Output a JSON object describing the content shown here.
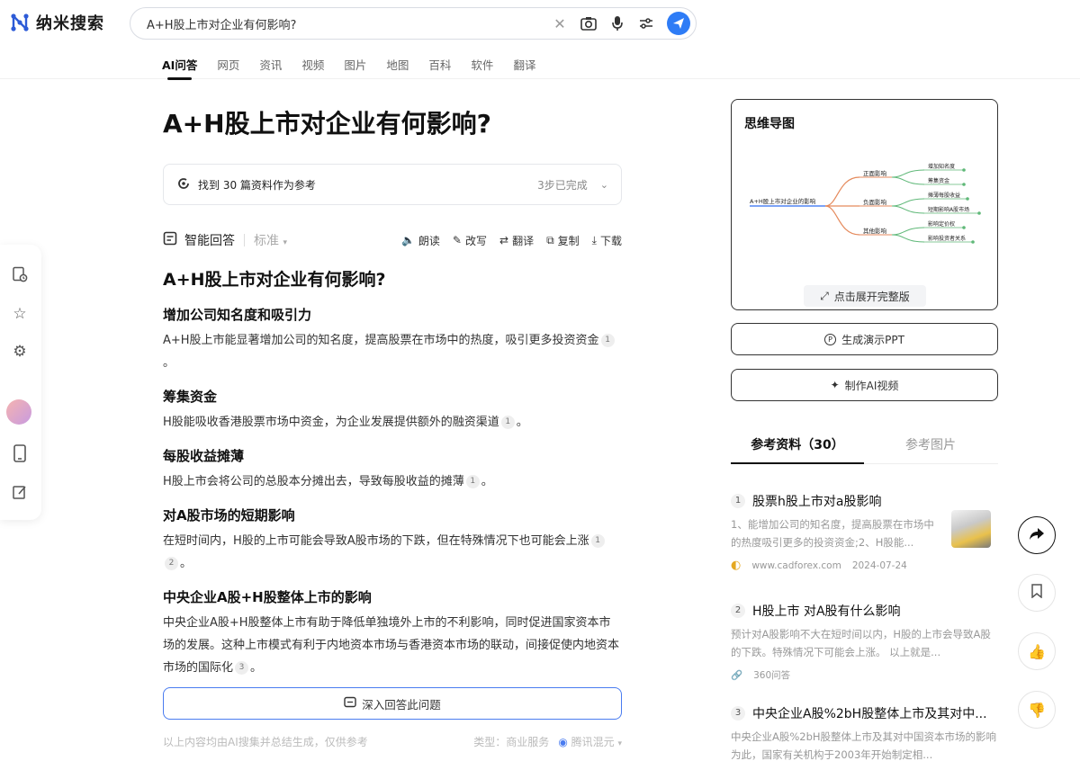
{
  "header": {
    "logo_text": "纳米搜索",
    "search_value": "A+H股上市对企业有何影响?",
    "tabs": [
      "AI问答",
      "网页",
      "资讯",
      "视频",
      "图片",
      "地图",
      "百科",
      "软件",
      "翻译"
    ]
  },
  "main": {
    "title": "A+H股上市对企业有何影响?",
    "ref_found": "找到 30 篇资料作为参考",
    "ref_status": "3步已完成",
    "answer_label": "智能回答",
    "mode_label": "标准",
    "actions": [
      "朗读",
      "改写",
      "翻译",
      "复制",
      "下载"
    ],
    "answer_title": "A+H股上市对企业有何影响?",
    "sections": [
      {
        "heading": "增加公司知名度和吸引力",
        "text": "A+H股上市能显著增加公司的知名度，提高股票在市场中的热度，吸引更多投资资金",
        "cites": [
          "1"
        ]
      },
      {
        "heading": "筹集资金",
        "text": "H股能吸收香港股票市场中资金，为企业发展提供额外的融资渠道",
        "cites": [
          "1"
        ]
      },
      {
        "heading": "每股收益摊薄",
        "text": "H股上市会将公司的总股本分摊出去，导致每股收益的摊薄",
        "cites": [
          "1"
        ]
      },
      {
        "heading": "对A股市场的短期影响",
        "text": "在短时间内，H股的上市可能会导致A股市场的下跌，但在特殊情况下也可能会上涨",
        "cites": [
          "1",
          "2"
        ]
      },
      {
        "heading": "中央企业A股+H股整体上市的影响",
        "text": "中央企业A股+H股整体上市有助于降低单独境外上市的不利影响，同时促进国家资本市场的发展。这种上市模式有利于内地资本市场与香港资本市场的联动，间接促使内地资本市场的国际化",
        "cites": [
          "3"
        ]
      }
    ],
    "deep_button": "深入回答此问题",
    "footer_left": "以上内容均由AI搜集并总结生成，仅供参考",
    "footer_type": "类型：商业服务",
    "footer_source": "腾讯混元"
  },
  "mindmap": {
    "title": "思维导图",
    "root": "A+H股上市对企业的影响",
    "branches": [
      {
        "label": "正面影响",
        "leaves": [
          "增加知名度",
          "筹集资金"
        ]
      },
      {
        "label": "负面影响",
        "leaves": [
          "摊薄每股收益",
          "短期影响A股市场"
        ]
      },
      {
        "label": "其他影响",
        "leaves": [
          "影响定价权",
          "影响投资者关系"
        ]
      }
    ],
    "expand_label": "点击展开完整版"
  },
  "side_buttons": {
    "ppt": "生成演示PPT",
    "video": "制作AI视频"
  },
  "references": {
    "tab_refs": "参考资料（30）",
    "tab_images": "参考图片",
    "items": [
      {
        "num": "1",
        "title": "股票h股上市对a股影响",
        "desc": "1、能增加公司的知名度，提高股票在市场中的热度吸引更多的投资资金;2、H股能...",
        "source": "www.cadforex.com",
        "date": "2024-07-24"
      },
      {
        "num": "2",
        "title": "H股上市 对A股有什么影响",
        "desc": "预计对A股影响不大在短时间以内，H股的上市会导致A股的下跌。特殊情况下可能会上涨。 以上就是...",
        "source": "360问答",
        "date": ""
      },
      {
        "num": "3",
        "title": "中央企业A股%2bH股整体上市及其对中...",
        "desc": "中央企业A股%2bH股整体上市及其对中国资本市场的影响 为此，国家有关机构于2003年开始制定相...",
        "source": "",
        "date": ""
      }
    ]
  }
}
